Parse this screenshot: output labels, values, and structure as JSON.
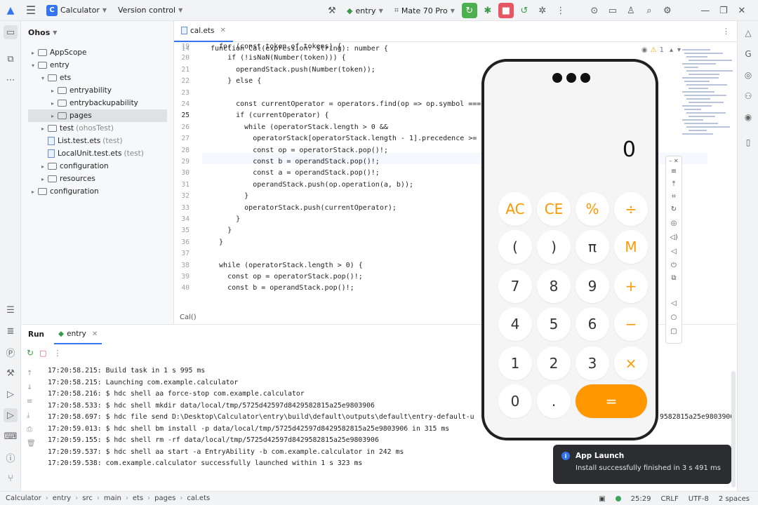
{
  "titlebar": {
    "project_badge": "C",
    "project_name": "Calculator",
    "vcs_label": "Version control",
    "run_config": "entry",
    "device": "Mate 70 Pro"
  },
  "project_panel": {
    "title": "Ohos",
    "tree": [
      {
        "label": "AppScope",
        "suffix": "",
        "kind": "folder",
        "arrow": "▸"
      },
      {
        "label": "entry",
        "suffix": "",
        "kind": "folder",
        "arrow": "▾"
      },
      {
        "label": "ets",
        "suffix": "",
        "kind": "folder",
        "arrow": "▾"
      },
      {
        "label": "entryability",
        "suffix": "",
        "kind": "folder",
        "arrow": "▸"
      },
      {
        "label": "entrybackupability",
        "suffix": "",
        "kind": "folder",
        "arrow": "▸"
      },
      {
        "label": "pages",
        "suffix": "",
        "kind": "folder",
        "arrow": "▸"
      },
      {
        "label": "test",
        "suffix": "(ohosTest)",
        "kind": "folder",
        "arrow": "▸"
      },
      {
        "label": "List.test.ets",
        "suffix": "(test)",
        "kind": "file",
        "arrow": ""
      },
      {
        "label": "LocalUnit.test.ets",
        "suffix": "(test)",
        "kind": "file",
        "arrow": ""
      },
      {
        "label": "configuration",
        "suffix": "",
        "kind": "folder",
        "arrow": "▸"
      },
      {
        "label": "resources",
        "suffix": "",
        "kind": "folder",
        "arrow": "▸"
      },
      {
        "label": "configuration",
        "suffix": "",
        "kind": "folder",
        "arrow": "▸"
      }
    ]
  },
  "editor": {
    "tab_label": "cal.ets",
    "warning_count": "1",
    "breadcrumb": "Cal()",
    "sticky_line": {
      "num": "14",
      "text": "function Cal(expression: string): number {"
    },
    "lines": [
      {
        "num": "19",
        "text": "  for (const token of tokens) {"
      },
      {
        "num": "20",
        "text": "    if (!isNaN(Number(token))) {"
      },
      {
        "num": "21",
        "text": "      operandStack.push(Number(token));"
      },
      {
        "num": "22",
        "text": "    } else {"
      },
      {
        "num": "23",
        "text": ""
      },
      {
        "num": "24",
        "text": "      const currentOperator = operators.find(op => op.symbol ==="
      },
      {
        "num": "25",
        "text": "      if (currentOperator) {"
      },
      {
        "num": "26",
        "text": "        while (operatorStack.length > 0 &&"
      },
      {
        "num": "27",
        "text": "          operatorStack[operatorStack.length - 1].precedence >= c"
      },
      {
        "num": "28",
        "text": "          const op = operatorStack.pop()!;"
      },
      {
        "num": "29",
        "text": "          const b = operandStack.pop()!;"
      },
      {
        "num": "30",
        "text": "          const a = operandStack.pop()!;"
      },
      {
        "num": "31",
        "text": "          operandStack.push(op.operation(a, b));"
      },
      {
        "num": "32",
        "text": "        }"
      },
      {
        "num": "33",
        "text": "        operatorStack.push(currentOperator);"
      },
      {
        "num": "34",
        "text": "      }"
      },
      {
        "num": "35",
        "text": "    }"
      },
      {
        "num": "36",
        "text": "  }"
      },
      {
        "num": "37",
        "text": ""
      },
      {
        "num": "38",
        "text": "  while (operatorStack.length > 0) {"
      },
      {
        "num": "39",
        "text": "    const op = operatorStack.pop()!;"
      },
      {
        "num": "40",
        "text": "    const b = operandStack.pop()!;"
      }
    ],
    "current_line": "25"
  },
  "run_panel": {
    "title": "Run",
    "tab_label": "entry",
    "console": [
      "17:20:58.215: Build task in 1 s 995 ms",
      "17:20:58.215: Launching com.example.calculator",
      "17:20:58.216: $ hdc shell aa force-stop com.example.calculator",
      "17:20:58.533: $ hdc shell mkdir data/local/tmp/5725d42597d8429582815a25e9803906",
      "17:20:58.697: $ hdc file send D:\\Desktop\\Calculator\\entry\\build\\default\\outputs\\default\\entry-default-u",
      "17:20:59.013: $ hdc shell bm install -p data/local/tmp/5725d42597d8429582815a25e9803906 in 315 ms",
      "17:20:59.155: $ hdc shell rm -rf data/local/tmp/5725d42597d8429582815a25e9803906",
      "17:20:59.537: $ hdc shell aa start -a EntryAbility -b com.example.calculator in 242 ms",
      "17:20:59.538: com.example.calculator successfully launched within 1 s 323 ms"
    ],
    "overflow_tail": "9582815a25e9803906'"
  },
  "phone": {
    "display_value": "0",
    "keys": [
      [
        "AC",
        "CE",
        "%",
        "÷"
      ],
      [
        "(",
        ")",
        "π",
        "M"
      ],
      [
        "7",
        "8",
        "9",
        "+"
      ],
      [
        "4",
        "5",
        "6",
        "−"
      ],
      [
        "1",
        "2",
        "3",
        "×"
      ],
      [
        "0",
        ".",
        "="
      ]
    ],
    "accent_color": "#ff9800"
  },
  "toast": {
    "title": "App Launch",
    "body": "Install successfully finished in 3 s 491 ms"
  },
  "statusbar": {
    "crumbs": [
      "Calculator",
      "entry",
      "src",
      "main",
      "ets",
      "pages",
      "cal.ets"
    ],
    "position": "25:29",
    "line_sep": "CRLF",
    "encoding": "UTF-8",
    "indent": "2 spaces"
  }
}
